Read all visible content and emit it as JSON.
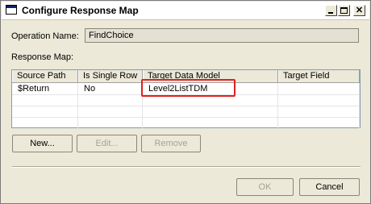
{
  "window": {
    "title": "Configure Response Map"
  },
  "operation": {
    "label": "Operation Name:",
    "value": "FindChoice"
  },
  "response_map": {
    "label": "Response Map:",
    "columns": [
      "Source Path",
      "Is Single Row",
      "Target Data Model",
      "Target Field"
    ],
    "rows": [
      [
        "$Return",
        "No",
        "Level2ListTDM",
        ""
      ]
    ]
  },
  "buttons": {
    "new": "New...",
    "edit": "Edit...",
    "remove": "Remove",
    "ok": "OK",
    "cancel": "Cancel"
  },
  "colors": {
    "highlight": "#e02020"
  },
  "icons": {
    "window": "window-icon",
    "minimize": "minimize-icon",
    "maximize": "maximize-icon",
    "close": "close-icon"
  }
}
